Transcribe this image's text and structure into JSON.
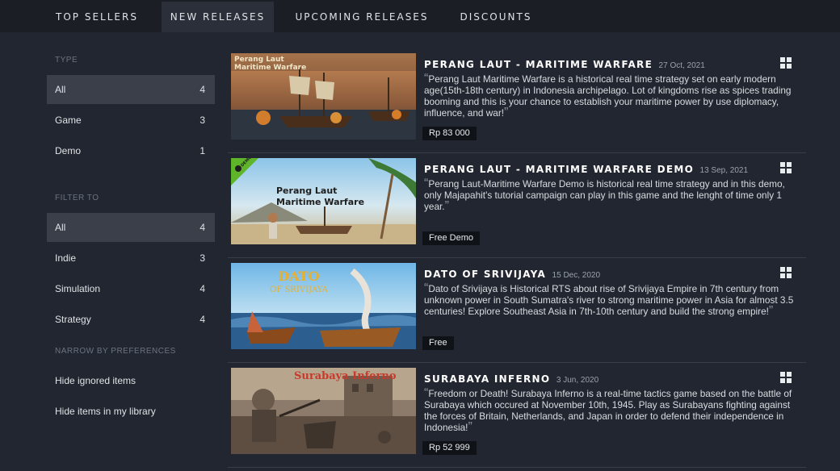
{
  "tabs": [
    {
      "label": "TOP SELLERS",
      "active": false
    },
    {
      "label": "NEW RELEASES",
      "active": true
    },
    {
      "label": "UPCOMING RELEASES",
      "active": false
    },
    {
      "label": "DISCOUNTS",
      "active": false
    }
  ],
  "sidebar": {
    "type_label": "TYPE",
    "type_items": [
      {
        "label": "All",
        "count": "4",
        "selected": true
      },
      {
        "label": "Game",
        "count": "3",
        "selected": false
      },
      {
        "label": "Demo",
        "count": "1",
        "selected": false
      }
    ],
    "filter_label": "FILTER TO",
    "filter_items": [
      {
        "label": "All",
        "count": "4",
        "selected": true
      },
      {
        "label": "Indie",
        "count": "3",
        "selected": false
      },
      {
        "label": "Simulation",
        "count": "4",
        "selected": false
      },
      {
        "label": "Strategy",
        "count": "4",
        "selected": false
      }
    ],
    "prefs_label": "NARROW BY PREFERENCES",
    "prefs_items": [
      {
        "label": "Hide ignored items"
      },
      {
        "label": "Hide items in my library"
      }
    ]
  },
  "games": [
    {
      "title": "PERANG LAUT - MARITIME WARFARE",
      "date": "27 Oct, 2021",
      "description": "Perang Laut Maritime Warfare is a historical real time strategy set on early modern age(15th-18th century) in Indonesia archipelago. Lot of kingdoms rise as spices trading booming and this is your chance to establish your maritime power by use diplomacy, influence, and war!",
      "price": "Rp 83 000",
      "platform_icon": "windows-icon",
      "capsule_text": [
        "Perang Laut",
        "Maritime Warfare"
      ]
    },
    {
      "title": "PERANG LAUT - MARITIME WARFARE DEMO",
      "date": "13 Sep, 2021",
      "description": "Perang Laut-Maritime Warfare Demo is historical real time strategy and in this demo, only Majapahit's tutorial campaign can play in this game and the lenght of time only 1 year.",
      "price": "Free Demo",
      "platform_icon": "windows-icon",
      "capsule_text": [
        "Perang Laut",
        "Maritime Warfare"
      ],
      "badge": "DEMO"
    },
    {
      "title": "DATO OF SRIVIJAYA",
      "date": "15 Dec, 2020",
      "description": "Dato of Srivijaya is Historical RTS about rise of Srivijaya Empire in 7th century from unknown power in South Sumatra's river to strong maritime power in Asia for almost 3.5 centuries! Explore Southeast Asia in 7th-10th century and build the strong empire!",
      "price": "Free",
      "platform_icon": "windows-icon",
      "capsule_text": [
        "DATO",
        "OF SRIVIJAYA"
      ]
    },
    {
      "title": "SURABAYA INFERNO",
      "date": "3 Jun, 2020",
      "description": "Freedom or Death! Surabaya Inferno is a real-time tactics game based on the battle of Surabaya which occured at November 10th, 1945. Play as Surabayans fighting against the forces of Britain, Netherlands, and Japan in order to defend their independence in Indonesia!",
      "price": "Rp 52 999",
      "platform_icon": "windows-icon",
      "capsule_text": [
        "Surabaya Inferno"
      ]
    }
  ],
  "colors": {
    "background": "#222630",
    "tabbar": "#1b1e25",
    "active_tab": "#2a2f3a",
    "selected_item": "#3a3f4a",
    "price_bg": "#0f1216"
  }
}
